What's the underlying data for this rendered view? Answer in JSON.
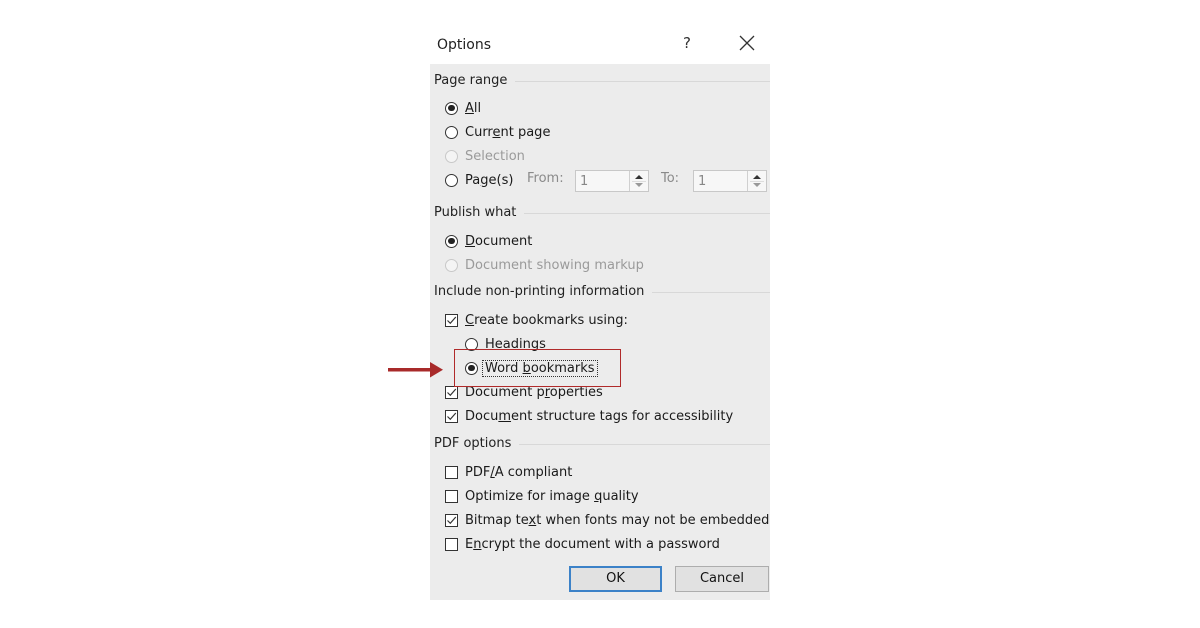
{
  "dialog": {
    "title": "Options",
    "help_label": "?",
    "close_icon": "close-x-icon"
  },
  "page_range": {
    "heading": "Page range",
    "options": [
      {
        "pre": "",
        "key": "A",
        "post": "ll",
        "checked": true,
        "disabled": false
      },
      {
        "pre": "Curr",
        "key": "e",
        "post": "nt page",
        "checked": false,
        "disabled": false
      },
      {
        "pre": "Selection",
        "key": "",
        "post": "",
        "checked": false,
        "disabled": true
      },
      {
        "pre": "Pa",
        "key": "g",
        "post": "e(s)",
        "checked": false,
        "disabled": false
      }
    ],
    "from_label": "From:",
    "from_value": "1",
    "to_label": "To:",
    "to_value": "1"
  },
  "publish_what": {
    "heading": "Publish what",
    "options": [
      {
        "pre": "",
        "key": "D",
        "post": "ocument",
        "checked": true,
        "disabled": false
      },
      {
        "pre": "Document showing markup",
        "key": "",
        "post": "",
        "checked": false,
        "disabled": true
      }
    ]
  },
  "non_printing": {
    "heading": "Include non-printing information",
    "create_bookmarks": {
      "pre": "",
      "key": "C",
      "post": "reate bookmarks using:",
      "checked": true
    },
    "bookmark_options": [
      {
        "pre": "",
        "key": "H",
        "post": "eadings",
        "checked": false
      },
      {
        "pre": "Word ",
        "key": "b",
        "post": "ookmarks",
        "checked": true
      }
    ],
    "checkboxes": [
      {
        "pre": "Document p",
        "key": "r",
        "post": "operties",
        "checked": true
      },
      {
        "pre": "Docu",
        "key": "m",
        "post": "ent structure tags for accessibility",
        "checked": true
      }
    ]
  },
  "pdf_options": {
    "heading": "PDF options",
    "checkboxes": [
      {
        "pre": "PDF",
        "key": "/",
        "post": "A compliant",
        "checked": false
      },
      {
        "pre": "Optimize for image ",
        "key": "q",
        "post": "uality",
        "checked": false
      },
      {
        "pre": "Bitmap te",
        "key": "x",
        "post": "t when fonts may not be embedded",
        "checked": true
      },
      {
        "pre": "E",
        "key": "n",
        "post": "crypt the document with a password",
        "checked": false
      }
    ]
  },
  "buttons": {
    "ok": "OK",
    "cancel": "Cancel"
  },
  "annotation": {
    "color": "#b02a2a",
    "target": "Word bookmarks"
  }
}
